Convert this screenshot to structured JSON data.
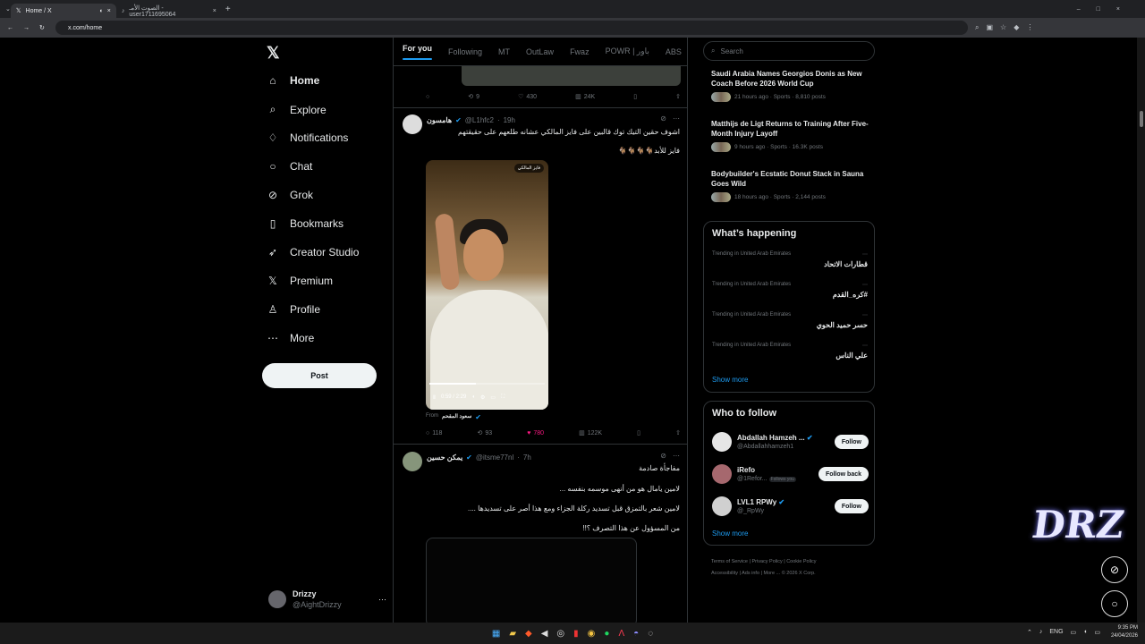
{
  "browser": {
    "tabs": [
      {
        "title": "Home / X",
        "icon": "x-logo-icon"
      },
      {
        "title": "الصوت الأمـ - user1711695064",
        "icon": "tiktok-icon"
      }
    ],
    "url": "x.com/home"
  },
  "sidebar": {
    "items": [
      {
        "label": "Home",
        "icon": "home-icon"
      },
      {
        "label": "Explore",
        "icon": "search-icon"
      },
      {
        "label": "Notifications",
        "icon": "bell-icon"
      },
      {
        "label": "Chat",
        "icon": "chat-icon"
      },
      {
        "label": "Grok",
        "icon": "grok-icon"
      },
      {
        "label": "Bookmarks",
        "icon": "bookmark-icon"
      },
      {
        "label": "Creator Studio",
        "icon": "rocket-icon"
      },
      {
        "label": "Premium",
        "icon": "x-icon"
      },
      {
        "label": "Profile",
        "icon": "person-icon"
      },
      {
        "label": "More",
        "icon": "more-icon"
      }
    ],
    "post_label": "Post",
    "account": {
      "name": "Drizzy",
      "handle": "@AightDrizzy"
    }
  },
  "feed": {
    "tabs": [
      "For you",
      "Following",
      "MT",
      "OutLaw",
      "Fwaz",
      "POWR | باور",
      "ABS"
    ],
    "first_actions": {
      "reposts": "9",
      "likes": "430",
      "views": "24K"
    },
    "post1": {
      "name": "هامسون",
      "handle": "@L1hfc2",
      "time": "19h",
      "text": "اشوف حقين التيك توك قالبين على فايز المالكي عشانه طلعهم على حقيقتهم",
      "subtext": "فايز للأبد🐐🐐🐐🐐",
      "video_badge": "فايز المالكي",
      "video_time": "0:59 / 2:29",
      "video_progress_pct": 40,
      "from_label": "From",
      "from_name": "سعود المقحم",
      "replies": "118",
      "reposts": "93",
      "likes": "780",
      "views": "122K"
    },
    "post2": {
      "name": "يمكن حسين",
      "handle": "@itsme77nl",
      "time": "7h",
      "line1": "مفاجأة صادمة",
      "line2": "لامين يامال هو من أنهى موسمه بنفسه ...",
      "line3": "لامين شعر بالتمزق قبل تسديد ركلة الجزاء ومع هذا أصر على تسديدها ....",
      "line4": "من المسؤول عن هذا التصرف ؟!!"
    }
  },
  "right": {
    "search_placeholder": "Search",
    "news": [
      {
        "title": "Saudi Arabia Names Georgios Donis as New Coach Before 2026 World Cup",
        "meta": "21 hours ago · Sports · 8,810 posts"
      },
      {
        "title": "Matthijs de Ligt Returns to Training After Five-Month Injury Layoff",
        "meta": "9 hours ago · Sports · 16.3K posts"
      },
      {
        "title": "Bodybuilder's Ecstatic Donut Stack in Sauna Goes Wild",
        "meta": "18 hours ago · Sports · 2,144 posts"
      }
    ],
    "happening_title": "What’s happening",
    "trends": [
      {
        "meta": "Trending in United Arab Emirates",
        "name": "قطارات الاتحاد"
      },
      {
        "meta": "Trending in United Arab Emirates",
        "name": "#كره_القدم"
      },
      {
        "meta": "Trending in United Arab Emirates",
        "name": "حسر حميد الحوي"
      },
      {
        "meta": "Trending in United Arab Emirates",
        "name": "علي الناس"
      }
    ],
    "show_more": "Show more",
    "who_title": "Who to follow",
    "follows": [
      {
        "name": "Abdallah Hamzeh ...",
        "handle": "@Abdallahhamzeh1",
        "button": "Follow",
        "badge": ""
      },
      {
        "name": "iRefo",
        "handle": "@1Refor...",
        "button": "Follow back",
        "badge": "Follows you"
      },
      {
        "name": "LVL1 RPWy",
        "handle": "@_RpWy",
        "button": "Follow",
        "badge": ""
      }
    ],
    "footer": [
      "Terms of Service",
      "Privacy Policy",
      "Cookie Policy",
      "Accessibility",
      "Ads info",
      "More ...",
      "© 2026 X Corp."
    ]
  },
  "system": {
    "lang": "ENG",
    "time": "9:35 PM",
    "date": "24/04/2026"
  },
  "overlay": {
    "logo": "DRZ"
  }
}
